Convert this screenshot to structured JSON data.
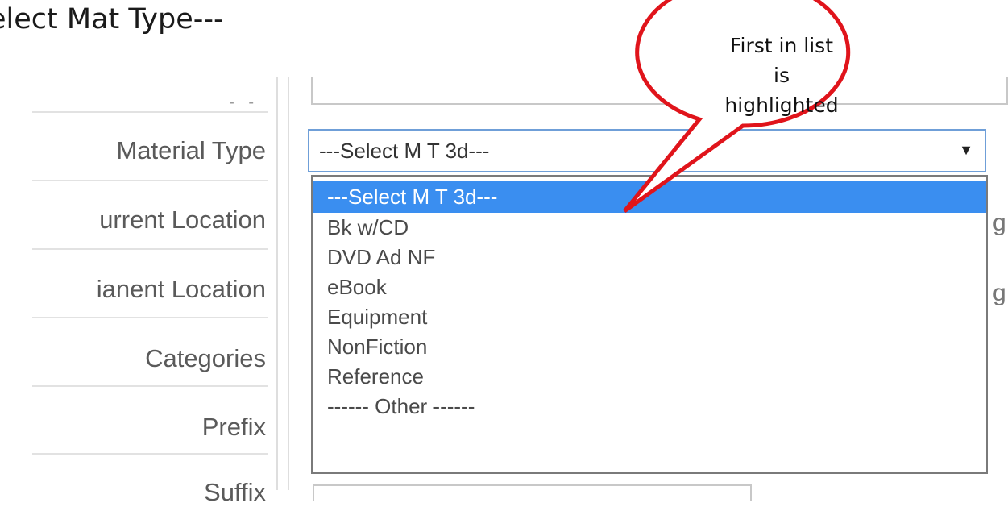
{
  "page": {
    "heading": "elect Mat Type---"
  },
  "form": {
    "faint_label": "- -",
    "rows": [
      {
        "label": "Material Type"
      },
      {
        "label": "urrent Location"
      },
      {
        "label": "ianent Location"
      },
      {
        "label": "Categories"
      },
      {
        "label": "Prefix"
      },
      {
        "label": "Suffix"
      }
    ],
    "side_chars": [
      "g",
      "g"
    ]
  },
  "material_select": {
    "selected": "---Select M T 3d---",
    "arrow_icon": "triangle-down-icon"
  },
  "dropdown": {
    "options": [
      {
        "label": "---Select M T 3d---",
        "highlighted": true
      },
      {
        "label": "Bk w/CD"
      },
      {
        "label": "DVD Ad NF"
      },
      {
        "label": "eBook"
      },
      {
        "label": "Equipment"
      },
      {
        "label": "NonFiction"
      },
      {
        "label": "Reference"
      },
      {
        "label": "------ Other ------"
      }
    ],
    "highlight_color": "#3a8ef0"
  },
  "callout": {
    "lines": [
      "First in list",
      "is",
      "highlighted"
    ],
    "color": "#e0141b"
  }
}
